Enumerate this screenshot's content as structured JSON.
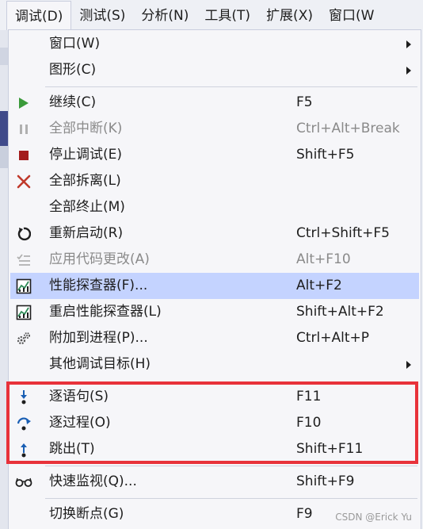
{
  "menubar": {
    "items": [
      "调试(D)",
      "测试(S)",
      "分析(N)",
      "工具(T)",
      "扩展(X)",
      "窗口(W"
    ]
  },
  "menu": {
    "items": [
      {
        "label": "窗口(W)",
        "shortcut": "",
        "submenu": true,
        "icon": "none",
        "disabled": false
      },
      {
        "label": "图形(C)",
        "shortcut": "",
        "submenu": true,
        "icon": "none",
        "disabled": false
      },
      {
        "label": "继续(C)",
        "shortcut": "F5",
        "icon": "play-icon",
        "disabled": false
      },
      {
        "label": "全部中断(K)",
        "shortcut": "Ctrl+Alt+Break",
        "icon": "pause-icon",
        "disabled": true
      },
      {
        "label": "停止调试(E)",
        "shortcut": "Shift+F5",
        "icon": "stop-icon",
        "disabled": false
      },
      {
        "label": "全部拆离(L)",
        "shortcut": "",
        "icon": "detach-x-icon",
        "disabled": false
      },
      {
        "label": "全部终止(M)",
        "shortcut": "",
        "icon": "none",
        "disabled": false
      },
      {
        "label": "重新启动(R)",
        "shortcut": "Ctrl+Shift+F5",
        "icon": "restart-icon",
        "disabled": false
      },
      {
        "label": "应用代码更改(A)",
        "shortcut": "Alt+F10",
        "icon": "apply-changes-icon",
        "disabled": true
      },
      {
        "label": "性能探查器(F)...",
        "shortcut": "Alt+F2",
        "icon": "profiler-icon",
        "disabled": false,
        "highlighted": true
      },
      {
        "label": "重启性能探查器(L)",
        "shortcut": "Shift+Alt+F2",
        "icon": "profiler-icon",
        "disabled": false
      },
      {
        "label": "附加到进程(P)...",
        "shortcut": "Ctrl+Alt+P",
        "icon": "gears-icon",
        "disabled": false
      },
      {
        "label": "其他调试目标(H)",
        "shortcut": "",
        "submenu": true,
        "icon": "none",
        "disabled": false
      },
      {
        "label": "逐语句(S)",
        "shortcut": "F11",
        "icon": "step-into-icon",
        "disabled": false
      },
      {
        "label": "逐过程(O)",
        "shortcut": "F10",
        "icon": "step-over-icon",
        "disabled": false
      },
      {
        "label": "跳出(T)",
        "shortcut": "Shift+F11",
        "icon": "step-out-icon",
        "disabled": false
      },
      {
        "label": "快速监视(Q)...",
        "shortcut": "Shift+F9",
        "icon": "glasses-icon",
        "disabled": false
      },
      {
        "label": "切换断点(G)",
        "shortcut": "F9",
        "icon": "none",
        "disabled": false
      }
    ]
  },
  "colors": {
    "accent_highlight": "#c4d3ff",
    "annotation_red": "#e8323a"
  },
  "watermark": "CSDN @Erick Yu"
}
